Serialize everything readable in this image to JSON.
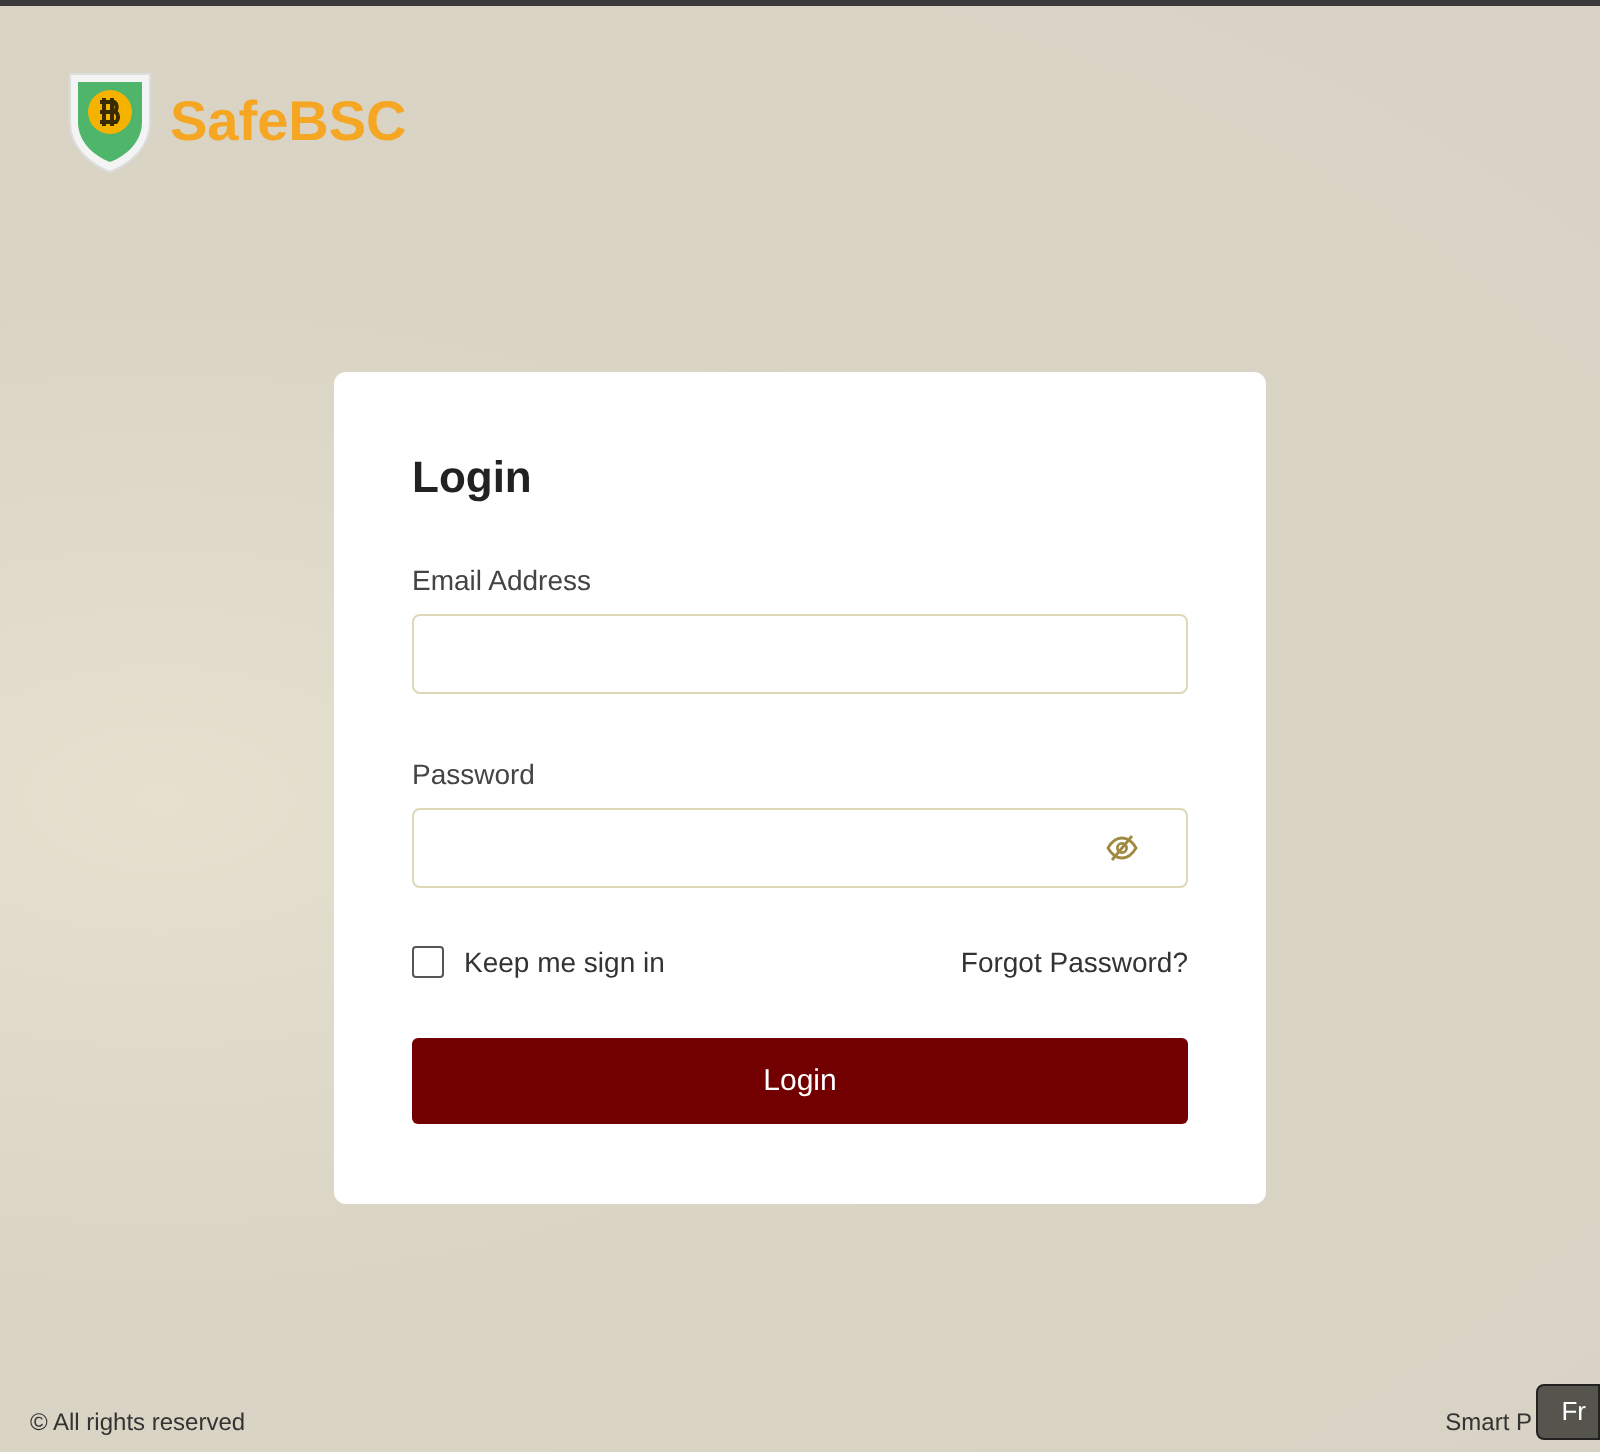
{
  "brand": {
    "name": "SafeBSC"
  },
  "login": {
    "title": "Login",
    "fields": [
      {
        "kind": "text",
        "label": "Email Address"
      },
      {
        "kind": "password",
        "label": "Password"
      }
    ],
    "remember": {
      "label": "Keep me sign in",
      "checked": false
    },
    "forgot": "Forgot Password?",
    "submit": "Login"
  },
  "footer": {
    "left": "© All rights reserved",
    "right": "Smart P",
    "badge": "Fr"
  }
}
